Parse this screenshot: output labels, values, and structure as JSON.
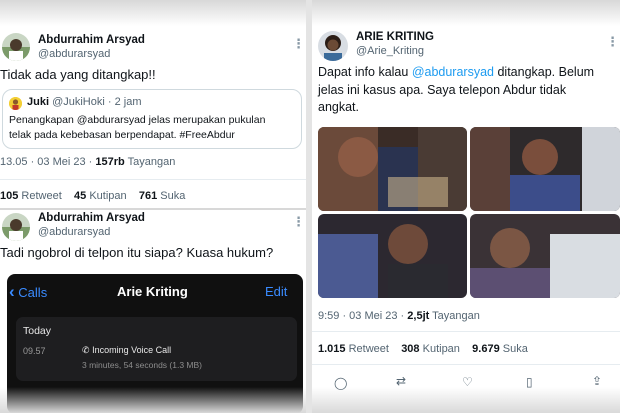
{
  "left": {
    "tweet1": {
      "author_name": "Abdurrahim Arsyad",
      "author_handle": "@abdurarsyad",
      "text": "Tidak ada yang ditangkap!!",
      "quote": {
        "author_name": "Juki",
        "author_handle": "@JukiHoki",
        "time": "· 2 jam",
        "text_line1": "Penangkapan @abdurarsyad jelas merupakan pukulan",
        "text_line2": "telak pada kebebasan berpendapat. #FreeAbdur"
      },
      "timestamp": "13.05 · 03 Mei 23 ·",
      "views_count": "157rb",
      "views_label": "Tayangan",
      "retweets_count": "105",
      "retweets_label": "Retweet",
      "quotes_count": "45",
      "quotes_label": "Kutipan",
      "likes_count": "761",
      "likes_label": "Suka"
    },
    "tweet2": {
      "author_name": "Abdurrahim Arsyad",
      "author_handle": "@abdurarsyad",
      "text": "Tadi ngobrol di telpon itu siapa? Kuasa hukum?"
    },
    "phone": {
      "back_label": "Calls",
      "contact_title": "Arie Kriting",
      "edit_label": "Edit",
      "section_label": "Today",
      "call_time": "09.57",
      "call_type": "Incoming Voice Call",
      "call_duration": "3 minutes, 54 seconds (1.3 MB)"
    }
  },
  "right": {
    "tweet": {
      "author_name": "ARIE KRITING",
      "author_handle": "@Arie_Kriting",
      "text_line1_pre": "Dapat info kalau ",
      "text_line1_mention": "@abdurarsyad",
      "text_line1_post": " ditangkap. Belum",
      "text_line2": "jelas ini kasus apa. Saya telepon Abdur tidak",
      "text_line3": "angkat.",
      "timestamp": "9:59 · 03 Mei 23 ·",
      "views_count": "2,5jt",
      "views_label": "Tayangan",
      "retweets_count": "1.015",
      "retweets_label": "Retweet",
      "quotes_count": "308",
      "quotes_label": "Kutipan",
      "likes_count": "9.679",
      "likes_label": "Suka"
    }
  },
  "colors": {
    "link": "#1d9bf0",
    "ios_blue": "#3a8bff",
    "muted": "#536471"
  },
  "icons": [
    "more-icon",
    "chevron-left-icon",
    "phone-icon",
    "reply-icon",
    "retweet-icon",
    "like-icon",
    "bookmark-icon",
    "share-icon"
  ]
}
